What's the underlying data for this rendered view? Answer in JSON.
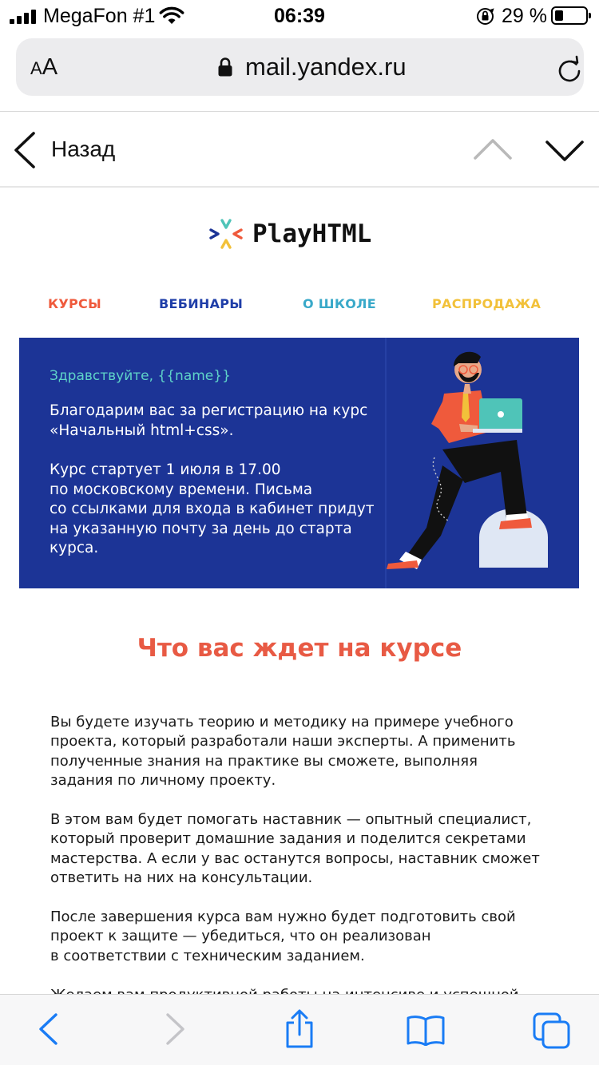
{
  "status_bar": {
    "carrier": "MegaFon #1",
    "time": "06:39",
    "battery_percent": "29 %",
    "battery_level": 0.29
  },
  "browser": {
    "text_size_label_small": "A",
    "text_size_label_big": "A",
    "url": "mail.yandex.ru"
  },
  "mail_nav": {
    "back_label": "Назад"
  },
  "email": {
    "brand_name": "PlayHTML",
    "nav": {
      "courses": "КУРСЫ",
      "webinars": "ВЕБИНАРЫ",
      "about": "О ШКОЛЕ",
      "sale": "РАСПРОДАЖА"
    },
    "hero": {
      "greeting": "Здравствуйте, {{name}}",
      "paragraph1_line1": "Благодарим вас за регистрацию на курс",
      "paragraph1_line2": "«Начальный html+css».",
      "paragraph2_line1": "Курс стартует 1 июля в 17.00",
      "paragraph2_line2": "по московскому времени. Письма",
      "paragraph2_line3": "со ссылками для входа в кабинет придут",
      "paragraph2_line4": "на указанную почту за день до старта",
      "paragraph2_line5": "курса."
    },
    "section_title": "Что вас ждет на курсе",
    "paragraphs": [
      {
        "l1": "Вы будете изучать теорию и методику на примере учебного",
        "l2": "проекта, который разработали наши эксперты. А применить",
        "l3": "полученные знания на практике вы сможете, выполняя",
        "l4": "задания по личному проекту."
      },
      {
        "l1": "В этом вам будет помогать наставник — опытный специалист,",
        "l2": "который проверит домашние задания и поделится секретами",
        "l3": "мастерства. А если у вас останутся вопросы, наставник сможет",
        "l4": "ответить на них на консультации."
      },
      {
        "l1": "После завершения курса вам нужно будет подготовить свой",
        "l2": "проект к защите — убедиться, что он реализован",
        "l3": "в соответствии с техническим заданием."
      },
      {
        "l1": "Желаем вам продуктивной работы на интенсиве и успешной"
      }
    ]
  },
  "colors": {
    "hero_background": "#1c3496",
    "greeting": "#5fd4c9",
    "section_title": "#e85a44",
    "nav_courses": "#ef5a3c",
    "nav_webinars": "#1f3ea8",
    "nav_about": "#39a9c9",
    "nav_sale": "#f2c13a",
    "safari_blue": "#1a7cf5"
  },
  "icons": {
    "wifi": "wifi-icon",
    "orientation_lock": "orientation-lock-icon",
    "battery": "battery-icon",
    "address_lock": "lock-icon",
    "reload": "reload-icon",
    "back": "chevron-left-icon",
    "prev_message": "chevron-up-icon",
    "next_message": "chevron-down-icon",
    "toolbar_back": "chevron-left-icon",
    "toolbar_forward": "chevron-right-icon",
    "share": "share-icon",
    "bookmarks": "book-icon",
    "tabs": "tabs-icon"
  }
}
